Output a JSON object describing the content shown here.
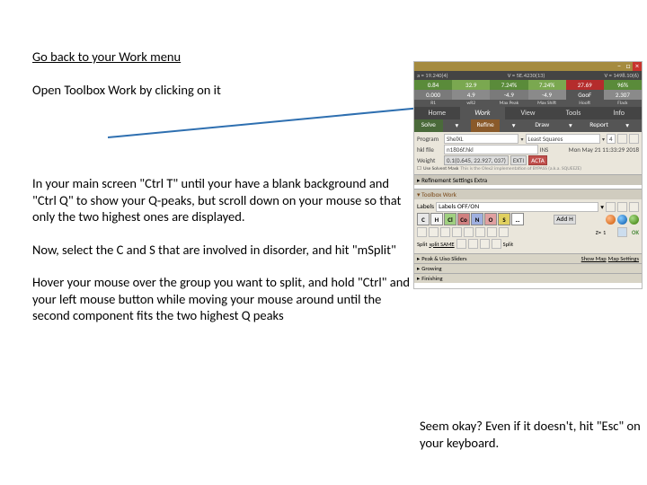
{
  "instructions": {
    "p1": "Go back to your Work menu",
    "p2": "Open Toolbox Work by clicking on it",
    "p3": "In your main screen \"Ctrl T\" until your have a blank background and \"Ctrl Q\" to show your Q-peaks, but scroll down on your mouse so that only the two highest ones are displayed.",
    "p4": "Now, select the C and S that are involved in disorder, and hit \"mSplit\"",
    "p5": "Hover your mouse over the group you want to split, and hold \"Ctrl\" and your left mouse button while moving your mouse around until the second component fits the two highest Q peaks"
  },
  "caption": "Seem okay? Even if it doesn't, hit \"Esc\" on your keyboard.",
  "app": {
    "status": {
      "left": "a = 19.240(4)",
      "mid": "V = 5E.4230(13)",
      "right": "V = 1498.10(6)"
    },
    "metrics": {
      "row1": [
        "0.84",
        "32.9",
        "7.24%",
        "7.24%",
        "27.69",
        "96%"
      ],
      "row2": [
        "0.000",
        "4.9",
        "-4.9",
        "-4.9",
        "GooF",
        "2.307"
      ],
      "labels": [
        "R1",
        "wR2",
        "Max Peak",
        "Max Shift",
        "Hooft",
        "Flack"
      ]
    },
    "tabs": [
      "Home",
      "Work",
      "View",
      "Tools",
      "Info"
    ],
    "toolbar": [
      "Solve",
      "Refine",
      "Draw",
      "Report"
    ],
    "refinement": {
      "program_label": "Program",
      "program": "ShelXL",
      "method": "Least Squares",
      "ls_num": "4",
      "file_label": "hkl file",
      "file": "n1806f.hkl",
      "file_date_label": "INS",
      "file_date": "Mon May 21 11:33:29 2018",
      "weight_label": "Weight",
      "weight": "0.1(0.645, 22.927, 037)",
      "ext": "EXTI",
      "acta": "ACTA",
      "mask_label": "Use Solvent Mask",
      "mask_note": "This is the Olex2 implementation of BYPASS (a.k.a. SQUEEZE)",
      "settings_label": "Refinement Settings Extra"
    },
    "toolbox": {
      "title": "Toolbox Work",
      "labels_label": "Labels",
      "labels": "Labels OFF/ON",
      "elements": [
        "C",
        "H",
        "Cl",
        "Co",
        "N",
        "O",
        "S"
      ],
      "addh": "Add H",
      "z_label": "Z=",
      "z": "1",
      "split_label": "Split",
      "same_label": "split SAME",
      "split": "Split",
      "ok": "OK",
      "rows": [
        "Peak & Uiso Sliders",
        "Growing",
        "Finishing"
      ],
      "showmap": "Show Map",
      "mapsettings": "Map Settings"
    }
  }
}
